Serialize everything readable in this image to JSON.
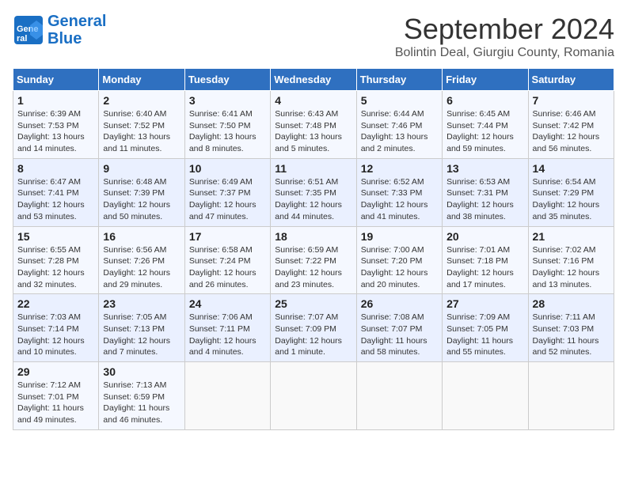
{
  "header": {
    "logo_line1": "General",
    "logo_line2": "Blue",
    "month_title": "September 2024",
    "subtitle": "Bolintin Deal, Giurgiu County, Romania"
  },
  "days_of_week": [
    "Sunday",
    "Monday",
    "Tuesday",
    "Wednesday",
    "Thursday",
    "Friday",
    "Saturday"
  ],
  "weeks": [
    [
      {
        "day": 1,
        "lines": [
          "Sunrise: 6:39 AM",
          "Sunset: 7:53 PM",
          "Daylight: 13 hours",
          "and 14 minutes."
        ]
      },
      {
        "day": 2,
        "lines": [
          "Sunrise: 6:40 AM",
          "Sunset: 7:52 PM",
          "Daylight: 13 hours",
          "and 11 minutes."
        ]
      },
      {
        "day": 3,
        "lines": [
          "Sunrise: 6:41 AM",
          "Sunset: 7:50 PM",
          "Daylight: 13 hours",
          "and 8 minutes."
        ]
      },
      {
        "day": 4,
        "lines": [
          "Sunrise: 6:43 AM",
          "Sunset: 7:48 PM",
          "Daylight: 13 hours",
          "and 5 minutes."
        ]
      },
      {
        "day": 5,
        "lines": [
          "Sunrise: 6:44 AM",
          "Sunset: 7:46 PM",
          "Daylight: 13 hours",
          "and 2 minutes."
        ]
      },
      {
        "day": 6,
        "lines": [
          "Sunrise: 6:45 AM",
          "Sunset: 7:44 PM",
          "Daylight: 12 hours",
          "and 59 minutes."
        ]
      },
      {
        "day": 7,
        "lines": [
          "Sunrise: 6:46 AM",
          "Sunset: 7:42 PM",
          "Daylight: 12 hours",
          "and 56 minutes."
        ]
      }
    ],
    [
      {
        "day": 8,
        "lines": [
          "Sunrise: 6:47 AM",
          "Sunset: 7:41 PM",
          "Daylight: 12 hours",
          "and 53 minutes."
        ]
      },
      {
        "day": 9,
        "lines": [
          "Sunrise: 6:48 AM",
          "Sunset: 7:39 PM",
          "Daylight: 12 hours",
          "and 50 minutes."
        ]
      },
      {
        "day": 10,
        "lines": [
          "Sunrise: 6:49 AM",
          "Sunset: 7:37 PM",
          "Daylight: 12 hours",
          "and 47 minutes."
        ]
      },
      {
        "day": 11,
        "lines": [
          "Sunrise: 6:51 AM",
          "Sunset: 7:35 PM",
          "Daylight: 12 hours",
          "and 44 minutes."
        ]
      },
      {
        "day": 12,
        "lines": [
          "Sunrise: 6:52 AM",
          "Sunset: 7:33 PM",
          "Daylight: 12 hours",
          "and 41 minutes."
        ]
      },
      {
        "day": 13,
        "lines": [
          "Sunrise: 6:53 AM",
          "Sunset: 7:31 PM",
          "Daylight: 12 hours",
          "and 38 minutes."
        ]
      },
      {
        "day": 14,
        "lines": [
          "Sunrise: 6:54 AM",
          "Sunset: 7:29 PM",
          "Daylight: 12 hours",
          "and 35 minutes."
        ]
      }
    ],
    [
      {
        "day": 15,
        "lines": [
          "Sunrise: 6:55 AM",
          "Sunset: 7:28 PM",
          "Daylight: 12 hours",
          "and 32 minutes."
        ]
      },
      {
        "day": 16,
        "lines": [
          "Sunrise: 6:56 AM",
          "Sunset: 7:26 PM",
          "Daylight: 12 hours",
          "and 29 minutes."
        ]
      },
      {
        "day": 17,
        "lines": [
          "Sunrise: 6:58 AM",
          "Sunset: 7:24 PM",
          "Daylight: 12 hours",
          "and 26 minutes."
        ]
      },
      {
        "day": 18,
        "lines": [
          "Sunrise: 6:59 AM",
          "Sunset: 7:22 PM",
          "Daylight: 12 hours",
          "and 23 minutes."
        ]
      },
      {
        "day": 19,
        "lines": [
          "Sunrise: 7:00 AM",
          "Sunset: 7:20 PM",
          "Daylight: 12 hours",
          "and 20 minutes."
        ]
      },
      {
        "day": 20,
        "lines": [
          "Sunrise: 7:01 AM",
          "Sunset: 7:18 PM",
          "Daylight: 12 hours",
          "and 17 minutes."
        ]
      },
      {
        "day": 21,
        "lines": [
          "Sunrise: 7:02 AM",
          "Sunset: 7:16 PM",
          "Daylight: 12 hours",
          "and 13 minutes."
        ]
      }
    ],
    [
      {
        "day": 22,
        "lines": [
          "Sunrise: 7:03 AM",
          "Sunset: 7:14 PM",
          "Daylight: 12 hours",
          "and 10 minutes."
        ]
      },
      {
        "day": 23,
        "lines": [
          "Sunrise: 7:05 AM",
          "Sunset: 7:13 PM",
          "Daylight: 12 hours",
          "and 7 minutes."
        ]
      },
      {
        "day": 24,
        "lines": [
          "Sunrise: 7:06 AM",
          "Sunset: 7:11 PM",
          "Daylight: 12 hours",
          "and 4 minutes."
        ]
      },
      {
        "day": 25,
        "lines": [
          "Sunrise: 7:07 AM",
          "Sunset: 7:09 PM",
          "Daylight: 12 hours",
          "and 1 minute."
        ]
      },
      {
        "day": 26,
        "lines": [
          "Sunrise: 7:08 AM",
          "Sunset: 7:07 PM",
          "Daylight: 11 hours",
          "and 58 minutes."
        ]
      },
      {
        "day": 27,
        "lines": [
          "Sunrise: 7:09 AM",
          "Sunset: 7:05 PM",
          "Daylight: 11 hours",
          "and 55 minutes."
        ]
      },
      {
        "day": 28,
        "lines": [
          "Sunrise: 7:11 AM",
          "Sunset: 7:03 PM",
          "Daylight: 11 hours",
          "and 52 minutes."
        ]
      }
    ],
    [
      {
        "day": 29,
        "lines": [
          "Sunrise: 7:12 AM",
          "Sunset: 7:01 PM",
          "Daylight: 11 hours",
          "and 49 minutes."
        ]
      },
      {
        "day": 30,
        "lines": [
          "Sunrise: 7:13 AM",
          "Sunset: 6:59 PM",
          "Daylight: 11 hours",
          "and 46 minutes."
        ]
      },
      null,
      null,
      null,
      null,
      null
    ]
  ]
}
